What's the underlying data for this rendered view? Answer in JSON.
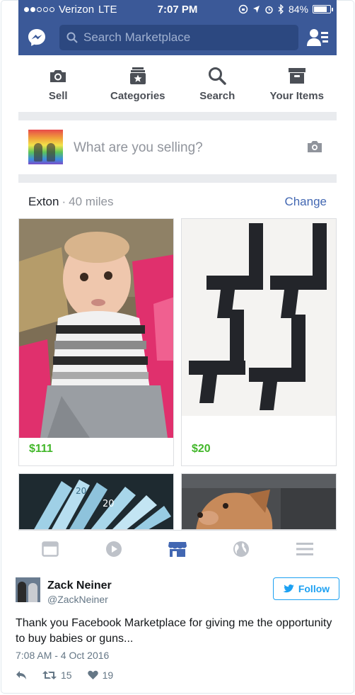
{
  "status_bar": {
    "carrier": "Verizon",
    "network": "LTE",
    "time": "7:07 PM",
    "battery": "84%",
    "battery_level": 0.84
  },
  "nav": {
    "search_placeholder": "Search Marketplace"
  },
  "tabs": [
    {
      "label": "Sell",
      "icon": "camera-icon"
    },
    {
      "label": "Categories",
      "icon": "categories-icon"
    },
    {
      "label": "Search",
      "icon": "search-icon"
    },
    {
      "label": "Your Items",
      "icon": "box-icon"
    }
  ],
  "composer": {
    "prompt": "What are you selling?"
  },
  "feed": {
    "location": "Exton",
    "distance": "40 miles",
    "change_label": "Change",
    "items": [
      {
        "price": "$111",
        "subject": "baby"
      },
      {
        "price": "$20",
        "subject": "pistols"
      },
      {
        "price": "",
        "subject": "banknotes",
        "text": "20"
      },
      {
        "price": "",
        "subject": "dog"
      }
    ]
  },
  "bottom_nav": [
    "feed-icon",
    "video-icon",
    "marketplace-icon",
    "globe-icon",
    "menu-icon"
  ],
  "tweet": {
    "name": "Zack Neiner",
    "handle": "@ZackNeiner",
    "follow_label": "Follow",
    "text": "Thank you Facebook Marketplace for giving me the opportunity to buy babies or guns...",
    "time": "7:08 AM - 4 Oct 2016",
    "retweets": "15",
    "likes": "19"
  },
  "colors": {
    "facebook_blue": "#3b5998",
    "price_green": "#42b72a",
    "twitter_blue": "#1da1f2",
    "link_blue": "#4267b2"
  }
}
